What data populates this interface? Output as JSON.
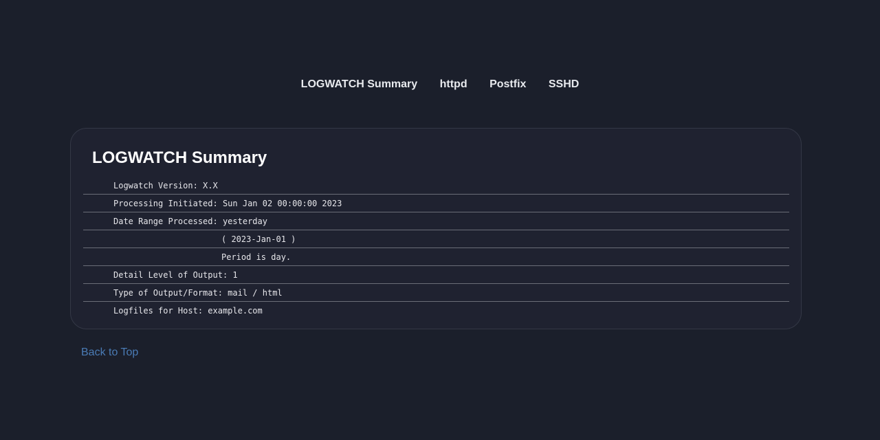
{
  "nav": {
    "links": [
      {
        "label": "LOGWATCH Summary"
      },
      {
        "label": "httpd"
      },
      {
        "label": "Postfix"
      },
      {
        "label": "SSHD"
      }
    ]
  },
  "section": {
    "title": "LOGWATCH Summary",
    "rows": [
      {
        "text": "Logwatch Version: X.X"
      },
      {
        "text": "Processing Initiated: Sun Jan 02 00:00:00 2023"
      },
      {
        "text": "Date Range Processed: yesterday"
      },
      {
        "text": "( 2023-Jan-01 )"
      },
      {
        "text": "Period is day."
      },
      {
        "text": "Detail Level of Output: 1"
      },
      {
        "text": "Type of Output/Format: mail / html"
      },
      {
        "text": "Logfiles for Host: example.com"
      }
    ]
  },
  "footer": {
    "back_to_top": "Back to Top"
  },
  "colors": {
    "background": "#1b1f2b",
    "card": "#1f2230",
    "link": "#4a7bb5"
  }
}
